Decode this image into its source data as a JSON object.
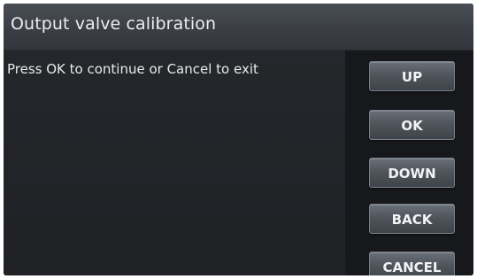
{
  "window": {
    "title": "Output valve calibration"
  },
  "content": {
    "message": "Press OK to continue or Cancel to exit"
  },
  "buttons": {
    "up": "UP",
    "ok": "OK",
    "down": "DOWN",
    "back": "BACK",
    "cancel": "CANCEL"
  }
}
